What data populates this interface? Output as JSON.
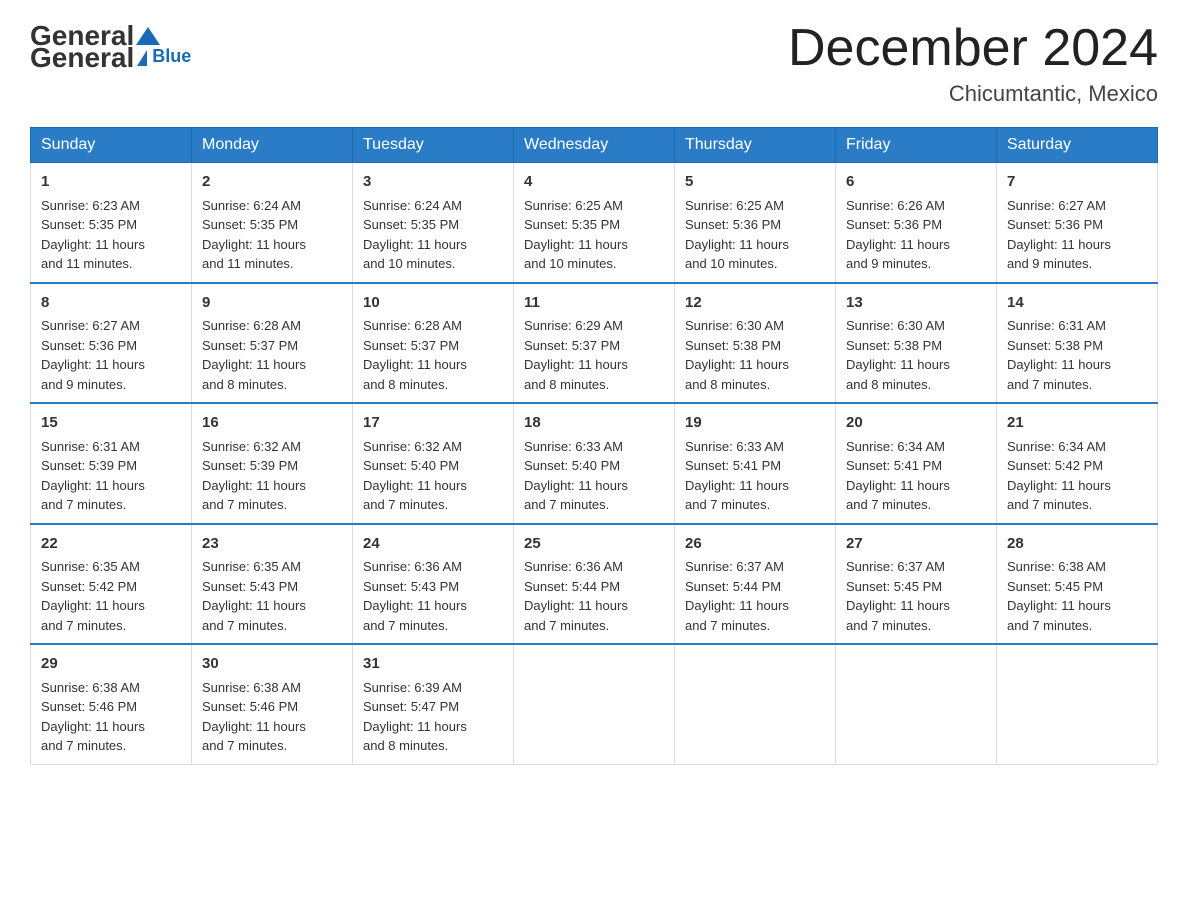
{
  "logo": {
    "general": "General",
    "blue": "Blue"
  },
  "header": {
    "title": "December 2024",
    "location": "Chicumtantic, Mexico"
  },
  "days_of_week": [
    "Sunday",
    "Monday",
    "Tuesday",
    "Wednesday",
    "Thursday",
    "Friday",
    "Saturday"
  ],
  "weeks": [
    [
      {
        "day": "1",
        "sunrise": "6:23 AM",
        "sunset": "5:35 PM",
        "daylight": "11 hours and 11 minutes."
      },
      {
        "day": "2",
        "sunrise": "6:24 AM",
        "sunset": "5:35 PM",
        "daylight": "11 hours and 11 minutes."
      },
      {
        "day": "3",
        "sunrise": "6:24 AM",
        "sunset": "5:35 PM",
        "daylight": "11 hours and 10 minutes."
      },
      {
        "day": "4",
        "sunrise": "6:25 AM",
        "sunset": "5:35 PM",
        "daylight": "11 hours and 10 minutes."
      },
      {
        "day": "5",
        "sunrise": "6:25 AM",
        "sunset": "5:36 PM",
        "daylight": "11 hours and 10 minutes."
      },
      {
        "day": "6",
        "sunrise": "6:26 AM",
        "sunset": "5:36 PM",
        "daylight": "11 hours and 9 minutes."
      },
      {
        "day": "7",
        "sunrise": "6:27 AM",
        "sunset": "5:36 PM",
        "daylight": "11 hours and 9 minutes."
      }
    ],
    [
      {
        "day": "8",
        "sunrise": "6:27 AM",
        "sunset": "5:36 PM",
        "daylight": "11 hours and 9 minutes."
      },
      {
        "day": "9",
        "sunrise": "6:28 AM",
        "sunset": "5:37 PM",
        "daylight": "11 hours and 8 minutes."
      },
      {
        "day": "10",
        "sunrise": "6:28 AM",
        "sunset": "5:37 PM",
        "daylight": "11 hours and 8 minutes."
      },
      {
        "day": "11",
        "sunrise": "6:29 AM",
        "sunset": "5:37 PM",
        "daylight": "11 hours and 8 minutes."
      },
      {
        "day": "12",
        "sunrise": "6:30 AM",
        "sunset": "5:38 PM",
        "daylight": "11 hours and 8 minutes."
      },
      {
        "day": "13",
        "sunrise": "6:30 AM",
        "sunset": "5:38 PM",
        "daylight": "11 hours and 8 minutes."
      },
      {
        "day": "14",
        "sunrise": "6:31 AM",
        "sunset": "5:38 PM",
        "daylight": "11 hours and 7 minutes."
      }
    ],
    [
      {
        "day": "15",
        "sunrise": "6:31 AM",
        "sunset": "5:39 PM",
        "daylight": "11 hours and 7 minutes."
      },
      {
        "day": "16",
        "sunrise": "6:32 AM",
        "sunset": "5:39 PM",
        "daylight": "11 hours and 7 minutes."
      },
      {
        "day": "17",
        "sunrise": "6:32 AM",
        "sunset": "5:40 PM",
        "daylight": "11 hours and 7 minutes."
      },
      {
        "day": "18",
        "sunrise": "6:33 AM",
        "sunset": "5:40 PM",
        "daylight": "11 hours and 7 minutes."
      },
      {
        "day": "19",
        "sunrise": "6:33 AM",
        "sunset": "5:41 PM",
        "daylight": "11 hours and 7 minutes."
      },
      {
        "day": "20",
        "sunrise": "6:34 AM",
        "sunset": "5:41 PM",
        "daylight": "11 hours and 7 minutes."
      },
      {
        "day": "21",
        "sunrise": "6:34 AM",
        "sunset": "5:42 PM",
        "daylight": "11 hours and 7 minutes."
      }
    ],
    [
      {
        "day": "22",
        "sunrise": "6:35 AM",
        "sunset": "5:42 PM",
        "daylight": "11 hours and 7 minutes."
      },
      {
        "day": "23",
        "sunrise": "6:35 AM",
        "sunset": "5:43 PM",
        "daylight": "11 hours and 7 minutes."
      },
      {
        "day": "24",
        "sunrise": "6:36 AM",
        "sunset": "5:43 PM",
        "daylight": "11 hours and 7 minutes."
      },
      {
        "day": "25",
        "sunrise": "6:36 AM",
        "sunset": "5:44 PM",
        "daylight": "11 hours and 7 minutes."
      },
      {
        "day": "26",
        "sunrise": "6:37 AM",
        "sunset": "5:44 PM",
        "daylight": "11 hours and 7 minutes."
      },
      {
        "day": "27",
        "sunrise": "6:37 AM",
        "sunset": "5:45 PM",
        "daylight": "11 hours and 7 minutes."
      },
      {
        "day": "28",
        "sunrise": "6:38 AM",
        "sunset": "5:45 PM",
        "daylight": "11 hours and 7 minutes."
      }
    ],
    [
      {
        "day": "29",
        "sunrise": "6:38 AM",
        "sunset": "5:46 PM",
        "daylight": "11 hours and 7 minutes."
      },
      {
        "day": "30",
        "sunrise": "6:38 AM",
        "sunset": "5:46 PM",
        "daylight": "11 hours and 7 minutes."
      },
      {
        "day": "31",
        "sunrise": "6:39 AM",
        "sunset": "5:47 PM",
        "daylight": "11 hours and 8 minutes."
      },
      null,
      null,
      null,
      null
    ]
  ],
  "labels": {
    "sunrise": "Sunrise:",
    "sunset": "Sunset:",
    "daylight": "Daylight:"
  }
}
